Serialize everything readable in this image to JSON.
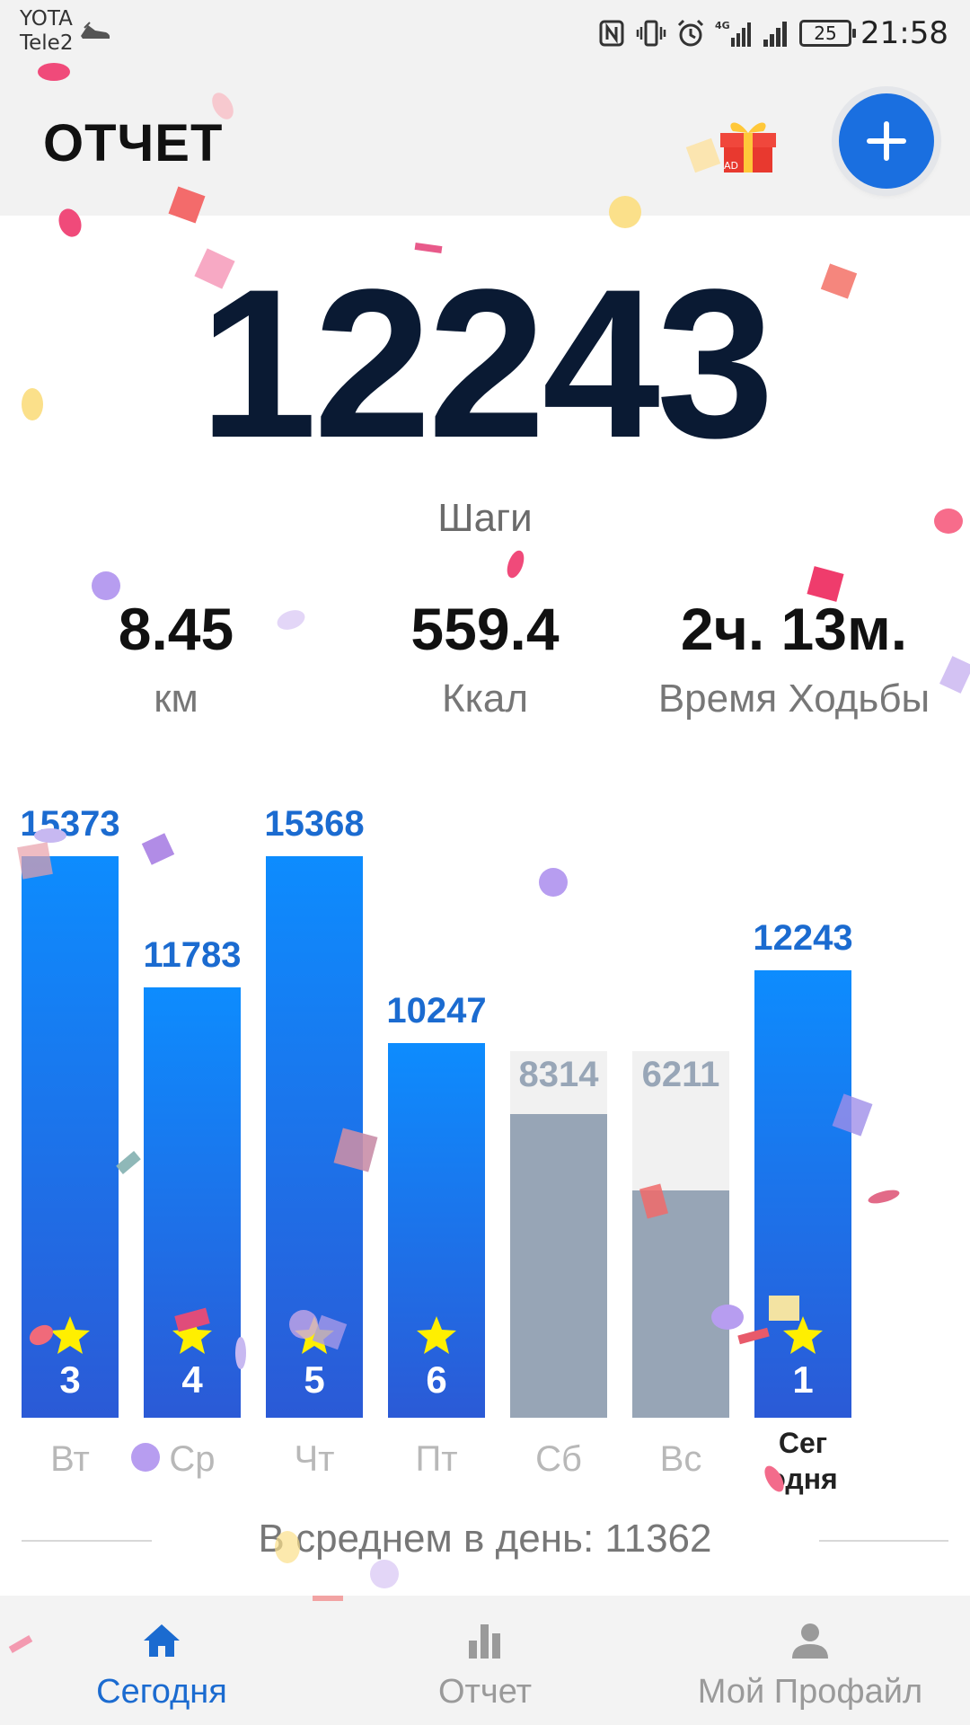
{
  "status_bar": {
    "carrier_1": "YOTA",
    "carrier_2": "Tele2",
    "battery": "25",
    "time": "21:58"
  },
  "header": {
    "title": "ОТЧЕТ",
    "gift_badge": "AD"
  },
  "summary": {
    "steps": "12243",
    "steps_label": "Шаги",
    "stats": [
      {
        "value": "8.45",
        "label": "км"
      },
      {
        "value": "559.4",
        "label": "Ккал"
      },
      {
        "value": "2ч. 13м.",
        "label": "Время Ходьбы"
      }
    ]
  },
  "chart_data": {
    "type": "bar",
    "categories": [
      "Вт",
      "Ср",
      "Чт",
      "Пт",
      "Сб",
      "Вс",
      "Сег одня"
    ],
    "values": [
      15373,
      11783,
      15368,
      10247,
      8314,
      6211,
      12243
    ],
    "value_labels": [
      "15373",
      "11783",
      "15368",
      "10247",
      "8314",
      "6211",
      "12243"
    ],
    "goal_reached": [
      true,
      true,
      true,
      true,
      false,
      false,
      true
    ],
    "ranks": [
      "3",
      "4",
      "5",
      "6",
      "",
      "",
      "1"
    ],
    "goal": 10000,
    "ylim": [
      0,
      16000
    ],
    "colors": {
      "goal_top": "#0d8cfe",
      "goal_bottom": "#2b5ad6",
      "missed": "#97a5b6",
      "missed_bg": "#f1f1f1",
      "label_blue": "#1b6bd0",
      "label_grey": "#98a6b7"
    }
  },
  "average": {
    "text": "В среднем в день: 11362"
  },
  "nav": {
    "items": [
      {
        "label": "Сегодня",
        "icon": "home-icon",
        "active": true
      },
      {
        "label": "Отчет",
        "icon": "bar-chart-icon",
        "active": false
      },
      {
        "label": "Мой Профайл",
        "icon": "person-icon",
        "active": false
      }
    ]
  },
  "colors": {
    "accent": "#1a6fe0",
    "header_bg": "#f2f2f2",
    "steps_text": "#0a1a33",
    "star": "#ffef00"
  }
}
